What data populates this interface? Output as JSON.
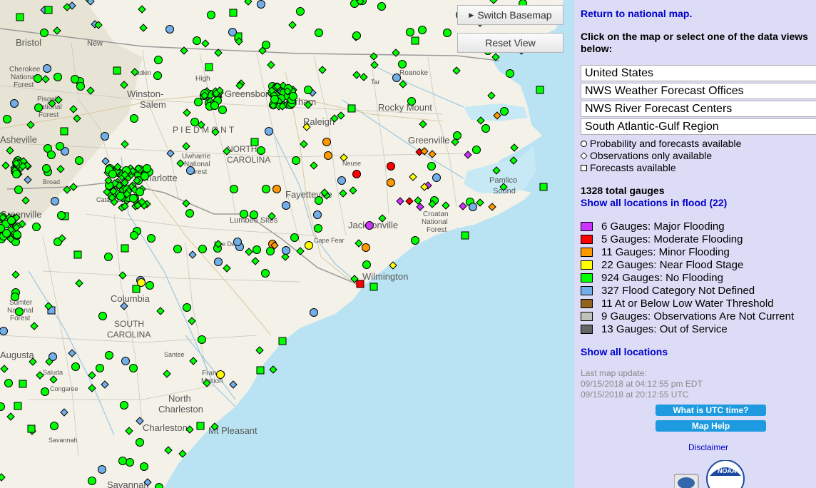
{
  "map": {
    "switch_basemap_label": "Switch Basemap",
    "reset_view_label": "Reset View",
    "labels": {
      "bristol": "Bristol",
      "new": "New",
      "winston": "Winston-",
      "salem": "Salem",
      "durham": "Durham",
      "raleigh": "Raleigh",
      "rocky_mount": "Rocky Mount",
      "greenville": "Greenville",
      "north": "NORTH",
      "carolina": "CAROLINA",
      "piedmont": "P I E D M O N T",
      "fayetteville": "Fayetteville",
      "lumbee": "Lumbee Sites",
      "jacksonville": "Jacksonville",
      "croatan": "Croatan",
      "croatan2": "National",
      "croatan3": "Forest",
      "pamlico": "Pamlico",
      "sound": "Sound",
      "wilmington": "Wilmington",
      "columbia": "Columbia",
      "south": "SOUTH",
      "south_carolina": "CAROLINA",
      "augusta": "Augusta",
      "sumter": "Sumter",
      "sumter2": "National",
      "sumter3": "Forest",
      "francis": "Francis",
      "marion": "Marion",
      "north_charleston": "North",
      "north_charleston2": "Charleston",
      "charleston": "Charleston",
      "mt_pleasant": "Mt Pleasant",
      "savannah": "Savannah",
      "cherokee": "Cherokee",
      "cherokee2": "National",
      "cherokee3": "Forest",
      "pisgah": "Pisgah",
      "pisgah2": "National",
      "pisgah3": "Forest",
      "uwharrie": "Uwharrie",
      "uwharrie2": "National",
      "uwharrie3": "Forest",
      "charlotte": "Charlotte",
      "greenville_sc": "Greenville",
      "asheville": "Asheville",
      "greensboro": "Greensboro",
      "high": "High",
      "roanoke": "Roanoke",
      "pee_dee": "Pee Dee",
      "cape_fear": "Cape Fear",
      "santee": "Santee",
      "broad": "Broad",
      "saluda": "Saluda",
      "congaree": "Congaree",
      "savannah_river": "Savannah",
      "catawba": "Catawba",
      "yadkin": "Yadkin",
      "tar": "Tar",
      "neuse": "Neuse"
    }
  },
  "panel": {
    "return_link": "Return to national map.",
    "instructions": "Click on the map or select one of the data views below:",
    "views": [
      "United States",
      "NWS Weather Forecast Offices",
      "NWS River Forecast Centers",
      "South Atlantic-Gulf Region"
    ],
    "symbol_legend": [
      {
        "shape": "circle",
        "label": "Probability and forecasts available"
      },
      {
        "shape": "diamond",
        "label": "Observations only available"
      },
      {
        "shape": "square",
        "label": "Forecasts available"
      }
    ],
    "total_gauges": "1328 total gauges",
    "flood_link": "Show all locations in flood (22)",
    "categories": [
      {
        "color": "#cc33ff",
        "label": "6 Gauges: Major Flooding"
      },
      {
        "color": "#ff0000",
        "label": "5 Gauges: Moderate Flooding"
      },
      {
        "color": "#ff9900",
        "label": "11 Gauges: Minor Flooding"
      },
      {
        "color": "#ffff00",
        "label": "22 Gauges: Near Flood Stage"
      },
      {
        "color": "#00ff00",
        "label": "924 Gauges: No Flooding"
      },
      {
        "color": "#72afe9",
        "label": "327 Flood Category Not Defined"
      },
      {
        "color": "#906320",
        "label": "11 At or Below Low Water Threshold"
      },
      {
        "color": "#bdc2bb",
        "label": "9 Gauges: Observations Are Not Current"
      },
      {
        "color": "#666666",
        "label": "13 Gauges: Out of Service"
      }
    ],
    "all_link": "Show all locations",
    "last_update_label": "Last map update",
    "last_update_suffix": ":",
    "last_update_edt": "09/15/2018 at 04:12:55 pm EDT",
    "last_update_utc": "09/15/2018 at 20:12:55 UTC",
    "utc_button": "What is UTC time?",
    "help_button": "Map Help",
    "disclaimer": "Disclaimer",
    "noaa_text": "NOAA"
  },
  "colors": {
    "major": "#cc33ff",
    "moderate": "#ff0000",
    "minor": "#ff9900",
    "near": "#ffff00",
    "none": "#00ff00",
    "undefined": "#72afe9",
    "ocean": "#b5e3f3",
    "land": "#f3f1e8",
    "panel": "#dcdcf6"
  }
}
